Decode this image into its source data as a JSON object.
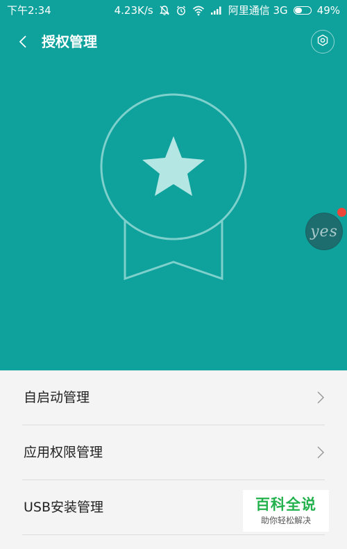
{
  "status_bar": {
    "time": "下午2:34",
    "network_speed": "4.23K/s",
    "carrier": "阿里通信 3G",
    "battery": "49%",
    "battery_level": 0.49,
    "icons": [
      "mute-icon",
      "alarm-icon",
      "wifi-icon",
      "signal-icon",
      "battery-icon"
    ]
  },
  "header": {
    "title": "授权管理",
    "back_icon": "chevron-left-icon",
    "settings_icon": "gear-icon"
  },
  "hero": {
    "background": "#0fa19c",
    "illustration": "badge-star-icon"
  },
  "floating_ball": {
    "label": "yes",
    "badge_color": "#f0463a"
  },
  "menu": {
    "items": [
      {
        "label": "自启动管理"
      },
      {
        "label": "应用权限管理"
      },
      {
        "label": "USB安装管理"
      }
    ]
  },
  "watermark": {
    "title": "百科全说",
    "subtitle": "助你轻松解决",
    "color": "#22b14c"
  }
}
